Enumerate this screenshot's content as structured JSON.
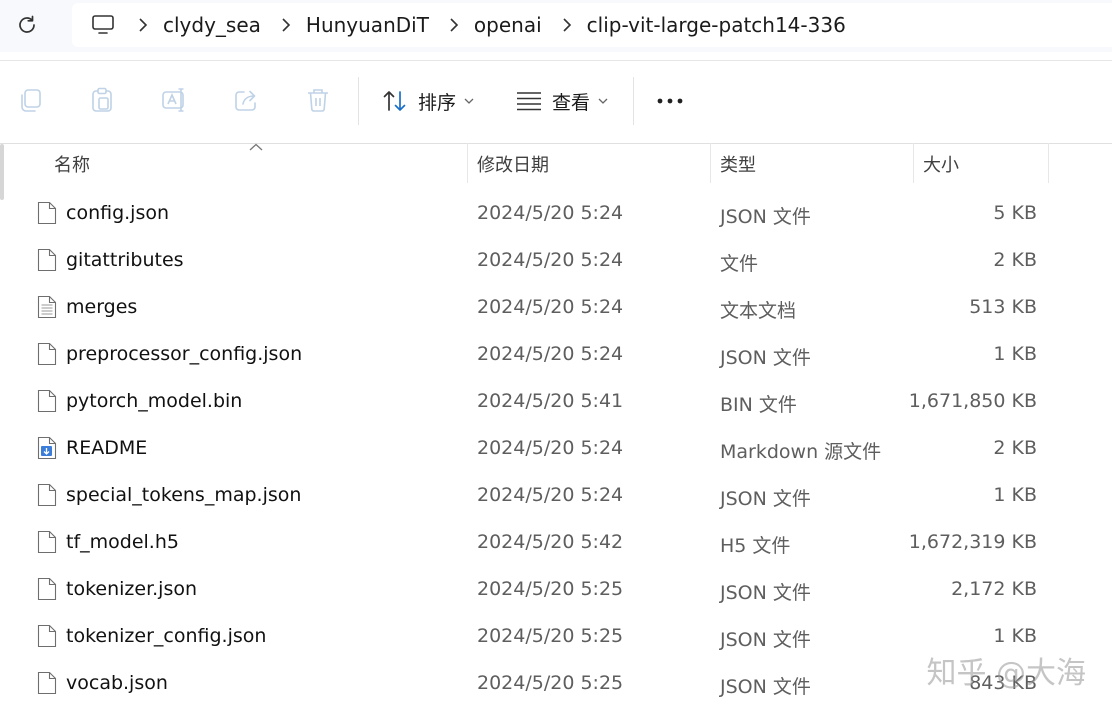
{
  "breadcrumb": [
    "clydy_sea",
    "HunyuanDiT",
    "openai",
    "clip-vit-large-patch14-336"
  ],
  "toolbar": {
    "sort_label": "排序",
    "view_label": "查看"
  },
  "columns": {
    "name": "名称",
    "date": "修改日期",
    "type": "类型",
    "size": "大小"
  },
  "files": [
    {
      "name": "config.json",
      "date": "2024/5/20 5:24",
      "type": "JSON 文件",
      "size": "5 KB",
      "icon": "file-icon"
    },
    {
      "name": "gitattributes",
      "date": "2024/5/20 5:24",
      "type": "文件",
      "size": "2 KB",
      "icon": "file-icon"
    },
    {
      "name": "merges",
      "date": "2024/5/20 5:24",
      "type": "文本文档",
      "size": "513 KB",
      "icon": "text-file-icon"
    },
    {
      "name": "preprocessor_config.json",
      "date": "2024/5/20 5:24",
      "type": "JSON 文件",
      "size": "1 KB",
      "icon": "file-icon"
    },
    {
      "name": "pytorch_model.bin",
      "date": "2024/5/20 5:41",
      "type": "BIN 文件",
      "size": "1,671,850 KB",
      "icon": "file-icon"
    },
    {
      "name": "README",
      "date": "2024/5/20 5:24",
      "type": "Markdown 源文件",
      "size": "2 KB",
      "icon": "markdown-file-icon"
    },
    {
      "name": "special_tokens_map.json",
      "date": "2024/5/20 5:24",
      "type": "JSON 文件",
      "size": "1 KB",
      "icon": "file-icon"
    },
    {
      "name": "tf_model.h5",
      "date": "2024/5/20 5:42",
      "type": "H5 文件",
      "size": "1,672,319 KB",
      "icon": "file-icon"
    },
    {
      "name": "tokenizer.json",
      "date": "2024/5/20 5:25",
      "type": "JSON 文件",
      "size": "2,172 KB",
      "icon": "file-icon"
    },
    {
      "name": "tokenizer_config.json",
      "date": "2024/5/20 5:25",
      "type": "JSON 文件",
      "size": "1 KB",
      "icon": "file-icon"
    },
    {
      "name": "vocab.json",
      "date": "2024/5/20 5:25",
      "type": "JSON 文件",
      "size": "843 KB",
      "icon": "file-icon"
    }
  ],
  "watermark": "知乎 @大海"
}
